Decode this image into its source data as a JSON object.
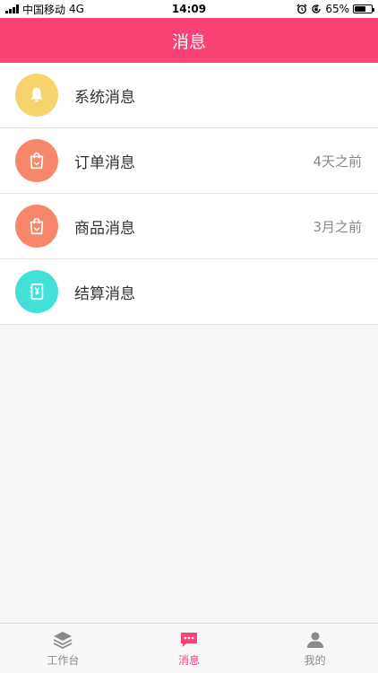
{
  "status_bar": {
    "carrier": "中国移动",
    "network": "4G",
    "time": "14:09",
    "battery": "65%",
    "battery_level": 0.65,
    "icons": [
      "signal-icon",
      "alarm-icon",
      "orientation-lock-icon",
      "battery-icon"
    ]
  },
  "header": {
    "title": "消息"
  },
  "messages": [
    {
      "title": "系统消息",
      "time": "",
      "icon": "bell-icon",
      "color": "#f7d36b"
    },
    {
      "title": "订单消息",
      "time": "4天之前",
      "icon": "shopping-bag-icon",
      "color": "#f7876a"
    },
    {
      "title": "商品消息",
      "time": "3月之前",
      "icon": "shopping-bag-icon",
      "color": "#f7876a"
    },
    {
      "title": "结算消息",
      "time": "",
      "icon": "yen-notebook-icon",
      "color": "#43e0d9"
    }
  ],
  "tabbar": {
    "tabs": [
      {
        "label": "工作台",
        "icon": "layers-icon",
        "active": false
      },
      {
        "label": "消息",
        "icon": "chat-bubble-icon",
        "active": true
      },
      {
        "label": "我的",
        "icon": "person-icon",
        "active": false
      }
    ],
    "active_color": "#fb4275",
    "inactive_color": "#8a8a8a"
  },
  "colors": {
    "accent": "#fb4275",
    "background": "#f5f5f5"
  }
}
